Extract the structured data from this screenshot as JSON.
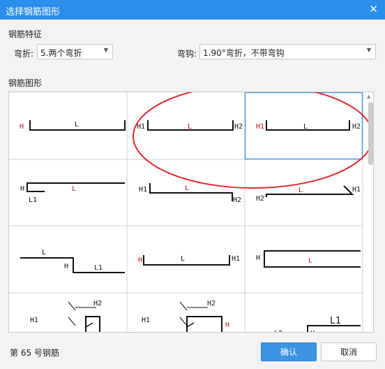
{
  "window": {
    "title": "选择钢筋图形",
    "close_icon": "close-icon"
  },
  "features": {
    "section_label": "钢筋特征",
    "bend_label": "弯折:",
    "bend_value": "5.两个弯折",
    "hook_label": "弯钩:",
    "hook_value": "1.90°弯折，不带弯钩"
  },
  "shapes": {
    "section_label": "钢筋图形",
    "selected_index": 2,
    "cells": [
      {
        "labels": [
          "H",
          "L"
        ]
      },
      {
        "labels": [
          "H1",
          "L",
          "H2"
        ]
      },
      {
        "labels": [
          "H1",
          "L",
          "H2"
        ]
      },
      {
        "labels": [
          "H",
          "L",
          "L1"
        ]
      },
      {
        "labels": [
          "H1",
          "L",
          "H2"
        ]
      },
      {
        "labels": [
          "H2",
          "L",
          "H1"
        ]
      },
      {
        "labels": [
          "L",
          "H",
          "L1"
        ]
      },
      {
        "labels": [
          "H",
          "L",
          "H1"
        ]
      },
      {
        "labels": [
          "H",
          "L"
        ]
      },
      {
        "labels": [
          "H1",
          "H2"
        ]
      },
      {
        "labels": [
          "H1",
          "H2",
          "H"
        ]
      },
      {
        "labels": [
          "L1",
          "L2",
          "H"
        ]
      }
    ]
  },
  "status": {
    "text": "第 65 号钢筋"
  },
  "buttons": {
    "ok": "确认",
    "cancel": "取消"
  },
  "colors": {
    "title_bar": "#2b8ee8",
    "highlight_ring": "#e0282c",
    "label_red": "#cc1111",
    "selection_border": "#4a9ae6"
  }
}
